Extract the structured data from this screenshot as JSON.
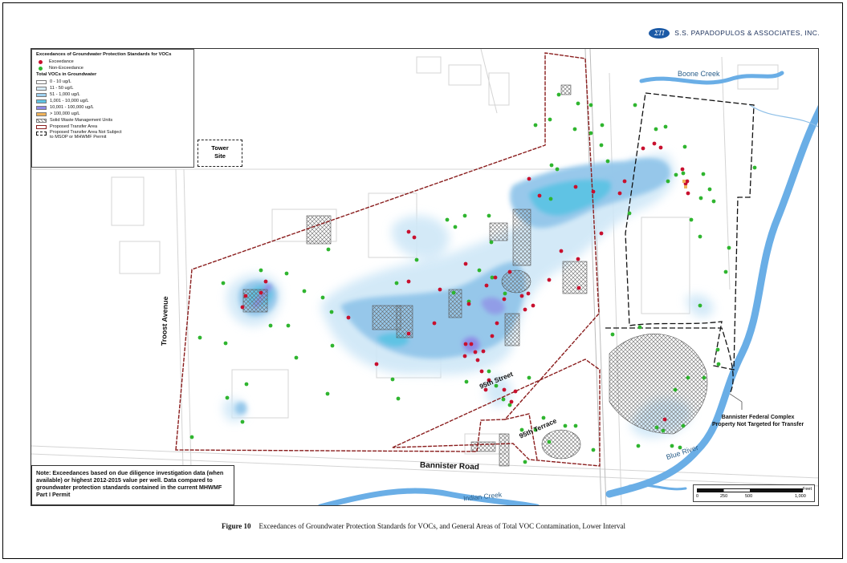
{
  "logo": {
    "symbol": "ΣΠ",
    "company": "S.S. PAPADOPULOS & ASSOCIATES, INC."
  },
  "legend": {
    "title": "Exceedances of Groundwater Protection Standards for VOCs",
    "exceedance": "Exceedance",
    "non_exceedance": "Non-Exceedance",
    "vocs_title": "Total VOCs in Groundwater",
    "classes": [
      "0 - 10 ug/L",
      "11 - 50 ug/L",
      "51 - 1,000 ug/L",
      "1,001 - 10,000 ug/L",
      "10,001 - 100,000 ug/L",
      "> 100,000 ug/L"
    ],
    "swmu": "Solid Waste Management Units",
    "transfer": "Proposed Transfer Area",
    "not_subject_line1": "Proposed Transfer Area Not Subject",
    "not_subject_line2": "to MSOP or MHWMF Permit"
  },
  "colors": {
    "class_colors": [
      "#ffffff",
      "#d8ecf8",
      "#9fd0ef",
      "#5fc3e4",
      "#8f8ae6",
      "#f0b35a"
    ],
    "exceedance": "#c8102e",
    "non_exceedance": "#2fb52f",
    "boundary": "#8a1d1d",
    "water": "#6aaee6"
  },
  "labels": {
    "tower_site_line1": "Tower",
    "tower_site_line2": "Site",
    "troost": "Troost Avenue",
    "street95": "95th Street",
    "terrace95": "95th Terrace",
    "bannister_road": "Bannister Road",
    "boone_creek": "Boone Creek",
    "blue_river": "Blue River",
    "indian_creek": "Indian Creek",
    "bannister_complex_line1": "Bannister Federal Complex",
    "bannister_complex_line2": "Property Not Targeted for Transfer"
  },
  "note": "Note: Exceedances based on due diligence investigation data (when available) or highest 2012-2015 value per well. Data compared to groundwater protection standards contained in the current MHWMF Part I Permit",
  "scale": {
    "unit": "Feet",
    "ticks": [
      "0",
      "250",
      "500",
      "1,000"
    ]
  },
  "caption": {
    "label": "Figure 10",
    "text": "Exceedances of Groundwater Protection Standards for VOCs, and General Areas of Total VOC Contamination, Lower Interval"
  }
}
